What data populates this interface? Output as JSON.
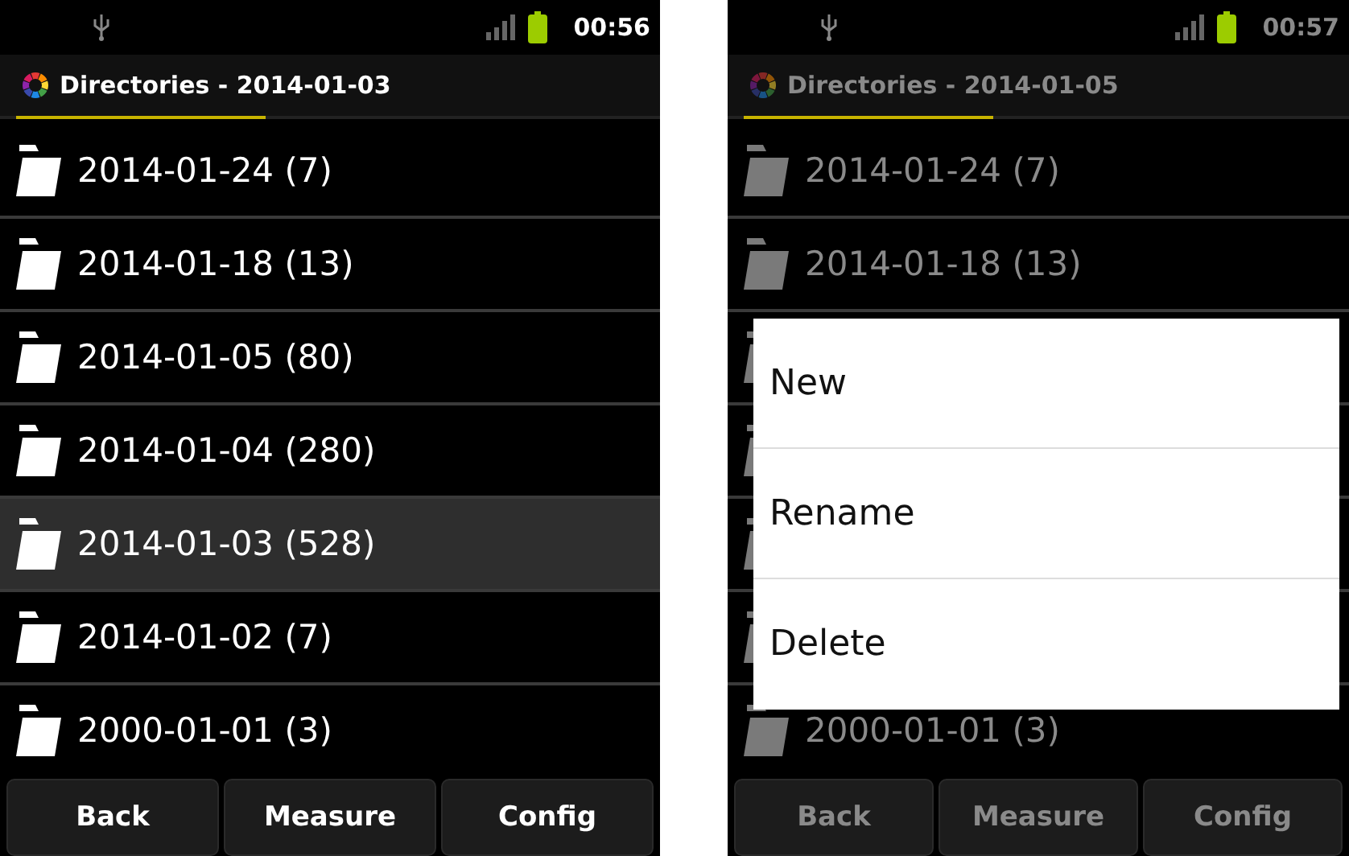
{
  "screens": [
    {
      "dimmed": false,
      "status_bar": {
        "time": "00:56"
      },
      "title": "Directories - 2014-01-03",
      "rows": [
        {
          "label": "2014-01-24 (7)",
          "selected": false
        },
        {
          "label": "2014-01-18 (13)",
          "selected": false
        },
        {
          "label": "2014-01-05 (80)",
          "selected": false
        },
        {
          "label": "2014-01-04 (280)",
          "selected": false
        },
        {
          "label": "2014-01-03 (528)",
          "selected": true
        },
        {
          "label": "2014-01-02 (7)",
          "selected": false
        },
        {
          "label": "2000-01-01 (3)",
          "selected": false
        }
      ],
      "buttons": [
        "Back",
        "Measure",
        "Config"
      ]
    },
    {
      "dimmed": true,
      "status_bar": {
        "time": "00:57"
      },
      "title": "Directories - 2014-01-05",
      "rows": [
        {
          "label": "2014-01-24 (7)",
          "selected": false
        },
        {
          "label": "2014-01-18 (13)",
          "selected": false
        },
        {
          "selected": false
        },
        {
          "selected": false
        },
        {
          "selected": false
        },
        {
          "selected": false
        },
        {
          "label": "2000-01-01 (3)",
          "selected": false
        }
      ],
      "buttons": [
        "Back",
        "Measure",
        "Config"
      ],
      "context_menu": [
        "New",
        "Rename",
        "Delete"
      ]
    }
  ]
}
